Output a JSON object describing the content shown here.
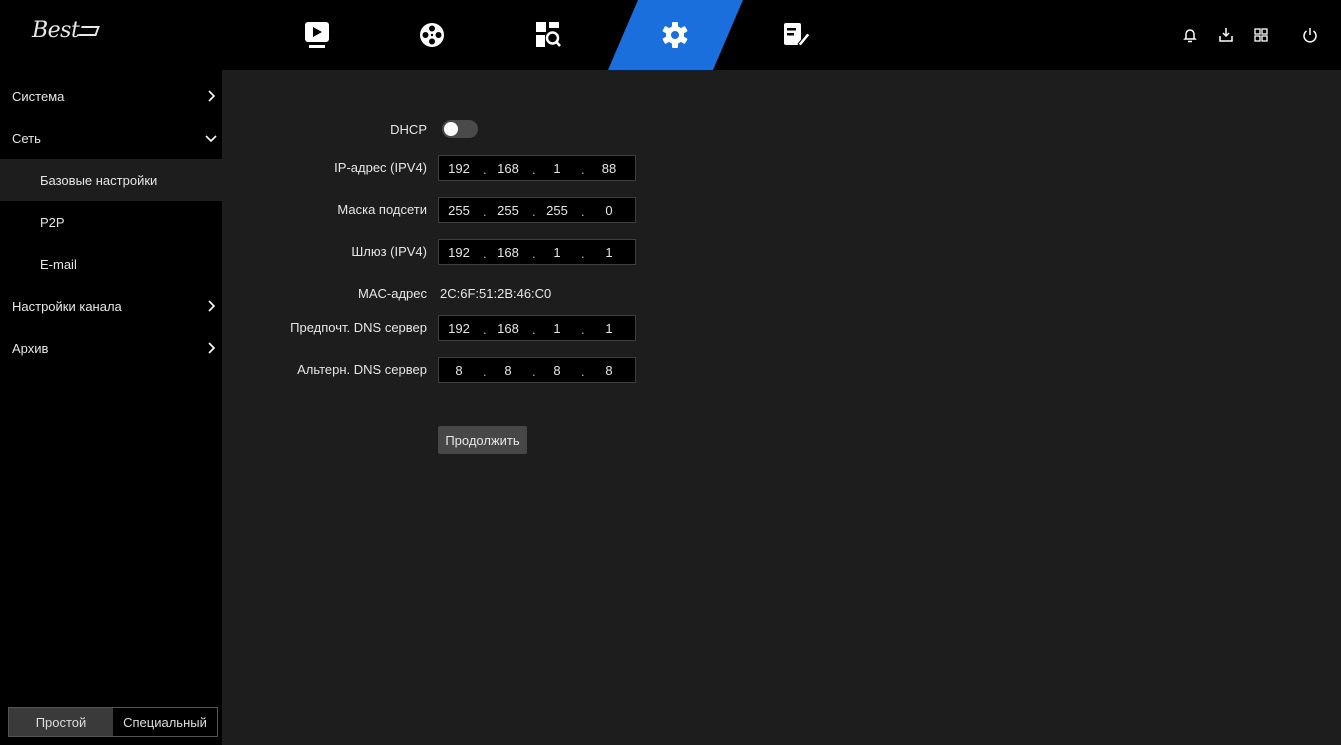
{
  "brand": {
    "logo_text": "Best"
  },
  "topnav": {
    "tabs": [
      {
        "name": "playback",
        "icon": "play-icon"
      },
      {
        "name": "film",
        "icon": "film-reel-icon"
      },
      {
        "name": "search",
        "icon": "search-grid-icon"
      },
      {
        "name": "settings",
        "icon": "gear-icon",
        "active": true
      },
      {
        "name": "maintenance",
        "icon": "edit-tool-icon"
      }
    ],
    "right_icons": [
      "bell-icon",
      "download-icon",
      "layout-icon",
      "power-icon"
    ],
    "accent_color": "#1a6fdc"
  },
  "sidebar": {
    "items": [
      {
        "label": "Система"
      },
      {
        "label": "Сеть"
      },
      {
        "label": "Базовые настройки"
      },
      {
        "label": "P2P"
      },
      {
        "label": "E-mail"
      },
      {
        "label": "Настройки канала"
      },
      {
        "label": "Архив"
      }
    ],
    "mode": {
      "simple": "Простой",
      "special": "Специальный"
    }
  },
  "form": {
    "dhcp": {
      "label": "DHCP",
      "enabled": false
    },
    "ip": {
      "label": "IP-адрес (IPV4)",
      "octets": [
        "192",
        "168",
        "1",
        "88"
      ]
    },
    "mask": {
      "label": "Маска подсети",
      "octets": [
        "255",
        "255",
        "255",
        "0"
      ]
    },
    "gateway": {
      "label": "Шлюз (IPV4)",
      "octets": [
        "192",
        "168",
        "1",
        "1"
      ]
    },
    "mac": {
      "label": "MAC-адрес",
      "value": "2C:6F:51:2B:46:C0"
    },
    "dns1": {
      "label": "Предпочт. DNS сервер",
      "octets": [
        "192",
        "168",
        "1",
        "1"
      ]
    },
    "dns2": {
      "label": "Альтерн. DNS сервер",
      "octets": [
        "8",
        "8",
        "8",
        "8"
      ]
    },
    "continue_label": "Продолжить"
  }
}
